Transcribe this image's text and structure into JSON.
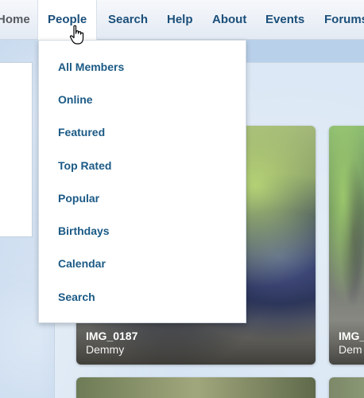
{
  "nav": {
    "items": [
      {
        "label": "Home"
      },
      {
        "label": "People"
      },
      {
        "label": "Search"
      },
      {
        "label": "Help"
      },
      {
        "label": "About"
      },
      {
        "label": "Events"
      },
      {
        "label": "Forums"
      }
    ],
    "active": "People"
  },
  "dropdown": {
    "items": [
      {
        "label": "All Members"
      },
      {
        "label": "Online"
      },
      {
        "label": "Featured"
      },
      {
        "label": "Top Rated"
      },
      {
        "label": "Popular"
      },
      {
        "label": "Birthdays"
      },
      {
        "label": "Calendar"
      },
      {
        "label": "Search"
      }
    ]
  },
  "photos": [
    {
      "title": "IMG_0187",
      "owner": "Demmy"
    },
    {
      "title": "IMG_",
      "owner": "Dem"
    }
  ],
  "colors": {
    "link": "#1b5a86",
    "nav_text": "#1b4f7a",
    "page_background": "#b9d0ea"
  },
  "cursor_icon": "hand-pointer-icon"
}
